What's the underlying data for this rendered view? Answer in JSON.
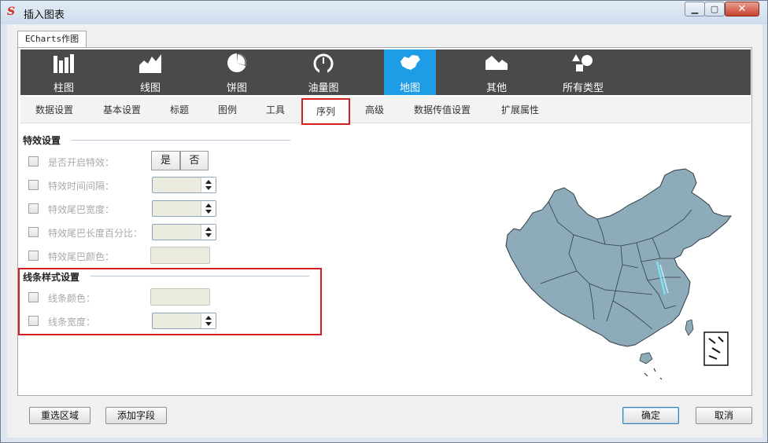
{
  "window": {
    "title": "插入图表",
    "logo": "S"
  },
  "outer_tab": {
    "label": "ECharts作图"
  },
  "chart_types": [
    {
      "label": "柱图",
      "icon": "bar-chart-icon"
    },
    {
      "label": "线图",
      "icon": "line-chart-icon"
    },
    {
      "label": "饼图",
      "icon": "pie-chart-icon"
    },
    {
      "label": "油量图",
      "icon": "gauge-icon"
    },
    {
      "label": "地图",
      "icon": "map-icon",
      "active": true
    },
    {
      "label": "其他",
      "icon": "other-chart-icon"
    },
    {
      "label": "所有类型",
      "icon": "all-types-icon"
    }
  ],
  "sub_tabs": [
    "数据设置",
    "基本设置",
    "标题",
    "图例",
    "工具",
    "序列",
    "高级",
    "数据传值设置",
    "扩展属性"
  ],
  "active_sub_tab": "序列",
  "effects": {
    "title": "特效设置",
    "enable_label": "是否开启特效：",
    "yes": "是",
    "no": "否",
    "interval_label": "特效时间间隔：",
    "tail_width_label": "特效尾巴宽度：",
    "tail_length_label": "特效尾巴长度百分比：",
    "tail_color_label": "特效尾巴颜色："
  },
  "line_style": {
    "title": "线条样式设置",
    "color_label": "线条颜色：",
    "width_label": "线条宽度："
  },
  "footer": {
    "reselect": "重选区域",
    "add_field": "添加字段",
    "ok": "确定",
    "cancel": "取消"
  },
  "colors": {
    "accent": "#1e9de6",
    "typebar": "#4a4a4a",
    "highlight": "#d21f1f",
    "map_fill": "#8dabb8"
  }
}
